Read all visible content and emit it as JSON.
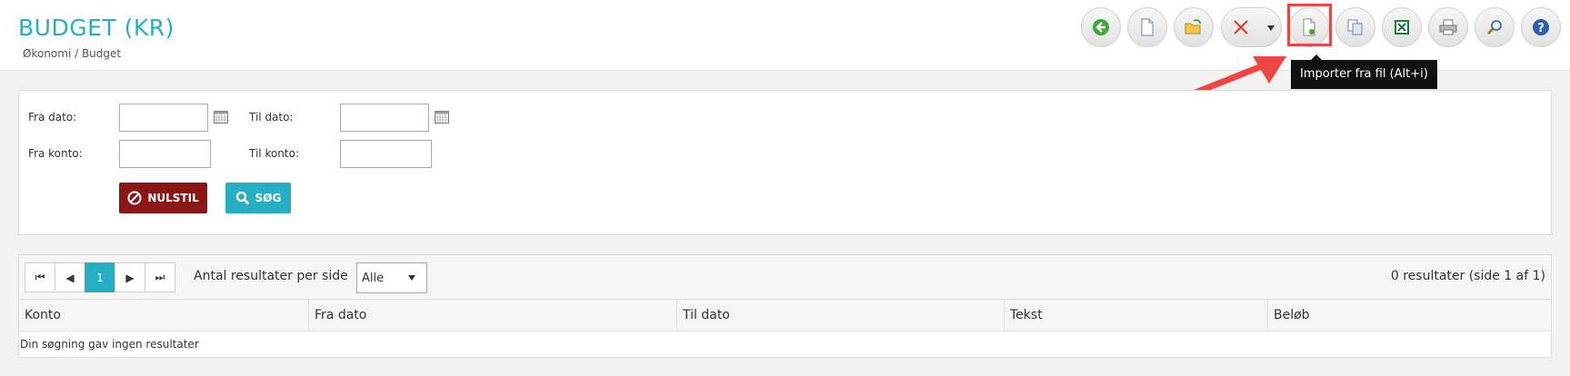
{
  "header": {
    "title": "BUDGET (KR)",
    "breadcrumb": "Økonomi / Budget"
  },
  "toolbar": {
    "buttons": [
      {
        "name": "back",
        "icon": "back-arrow-icon"
      },
      {
        "name": "new",
        "icon": "new-document-icon"
      },
      {
        "name": "open",
        "icon": "open-folder-icon"
      },
      {
        "name": "delete",
        "icon": "delete-x-icon"
      },
      {
        "name": "import",
        "icon": "import-file-icon"
      },
      {
        "name": "copy",
        "icon": "copy-icon"
      },
      {
        "name": "excel",
        "icon": "excel-icon"
      },
      {
        "name": "print",
        "icon": "printer-icon"
      },
      {
        "name": "search",
        "icon": "magnifier-icon"
      },
      {
        "name": "help",
        "icon": "help-icon"
      }
    ],
    "tooltip": "Importer fra fil (Alt+i)"
  },
  "filters": {
    "from_date_label": "Fra dato:",
    "from_date_value": "",
    "to_date_label": "Til dato:",
    "to_date_value": "",
    "from_account_label": "Fra konto:",
    "from_account_value": "",
    "to_account_label": "Til konto:",
    "to_account_value": "",
    "reset_label": "NULSTIL",
    "search_label": "SØG"
  },
  "results": {
    "pager": {
      "first": "⏮",
      "prev": "◀",
      "current": "1",
      "next": "▶",
      "last": "⏭"
    },
    "per_page_label": "Antal resultater per side",
    "per_page_value": "Alle",
    "count_text": "0 resultater (side 1 af 1)",
    "columns": [
      "Konto",
      "Fra dato",
      "Til dato",
      "Tekst",
      "Beløb"
    ],
    "empty_message": "Din søgning gav ingen resultater"
  },
  "colors": {
    "accent": "#25aec4",
    "danger": "#8b1616",
    "highlight": "#e84747"
  }
}
